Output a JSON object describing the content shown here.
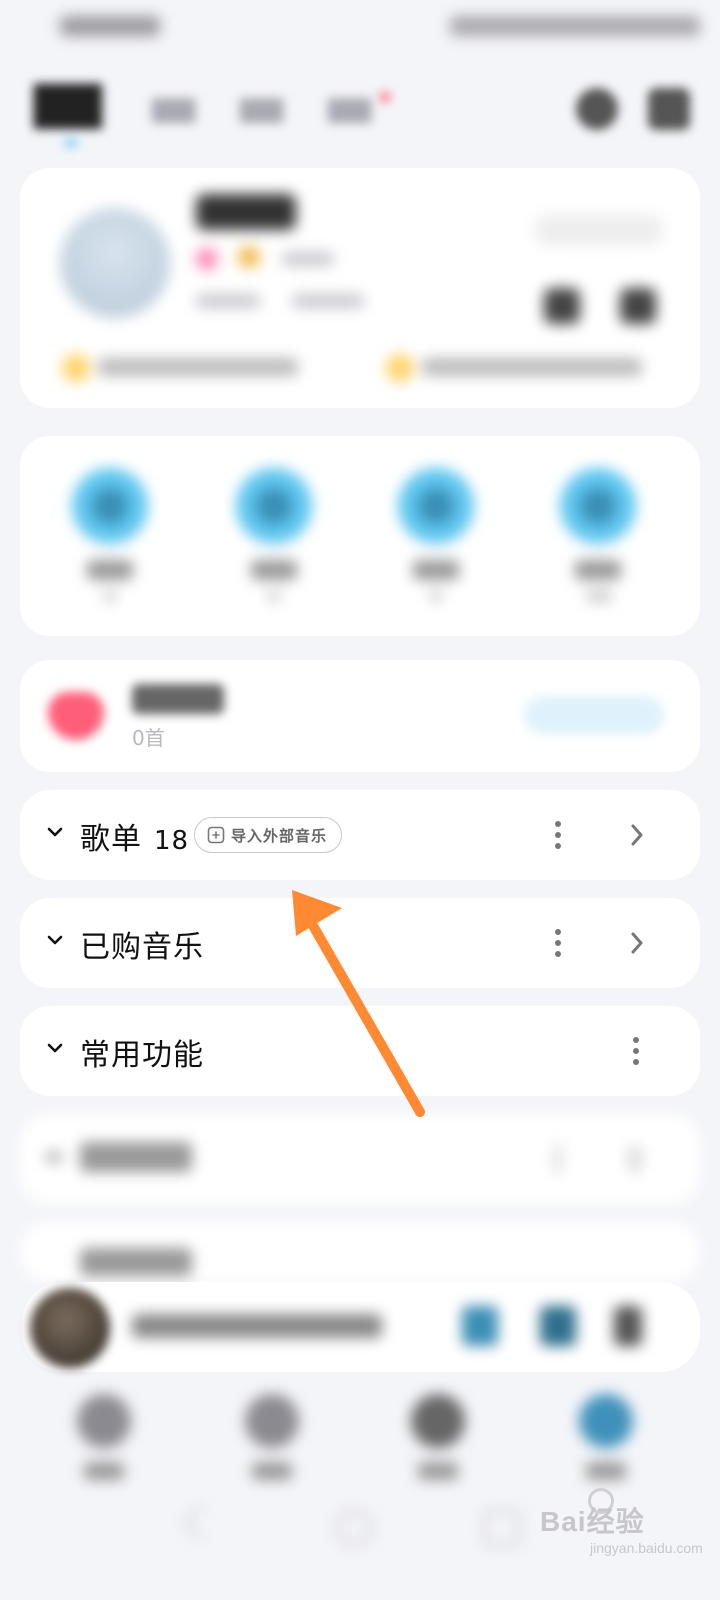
{
  "liked": {
    "count_label": "0首"
  },
  "sections": [
    {
      "title": "歌单",
      "count": "18",
      "import_label": "导入外部音乐"
    },
    {
      "title": "已购音乐"
    },
    {
      "title": "常用功能"
    }
  ],
  "watermark": {
    "brand": "Bai经验",
    "sub": "jingyan.baidu.com"
  },
  "colors": {
    "accent_blue": "#5fc6ef",
    "heart": "#ff5e78",
    "annotation_arrow": "#ff8a33",
    "card_bg": "#ffffff",
    "page_bg": "#f4f5f9"
  }
}
